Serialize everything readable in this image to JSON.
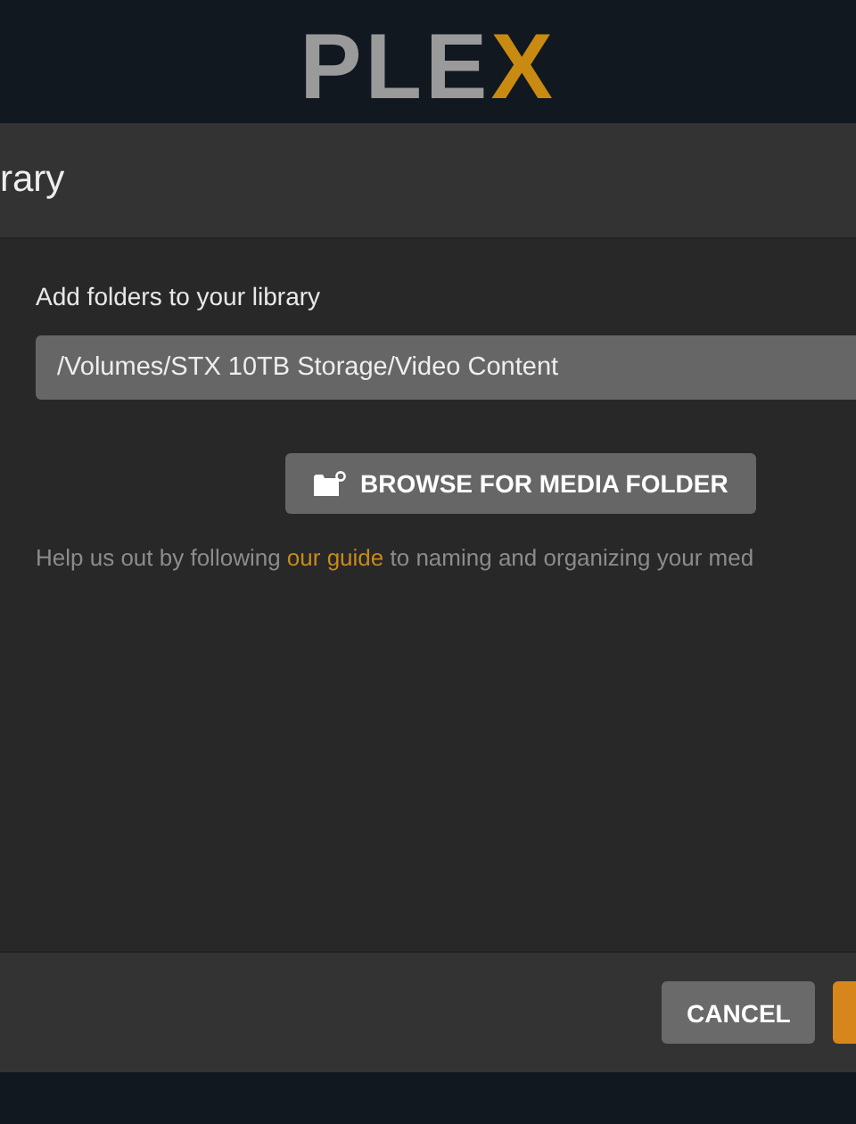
{
  "logo": {
    "text": "PLE",
    "accent": "X"
  },
  "dialog": {
    "title": "rary",
    "section_label": "Add folders to your library",
    "folder_path": "/Volumes/STX 10TB Storage/Video Content",
    "browse_button": "BROWSE FOR MEDIA FOLDER",
    "help": {
      "before": "Help us out by following ",
      "link": "our guide",
      "after": " to naming and organizing your med"
    },
    "buttons": [
      {
        "label": "CANCEL",
        "kind": "secondary"
      },
      {
        "kind": "primary"
      }
    ]
  }
}
